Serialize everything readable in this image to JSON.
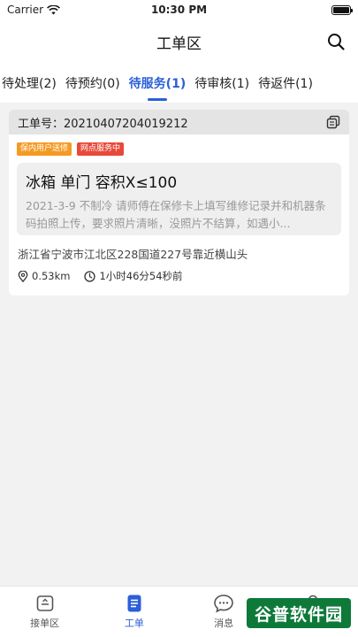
{
  "status_bar": {
    "carrier": "Carrier",
    "time": "10:30 PM"
  },
  "nav": {
    "title": "工单区"
  },
  "tabs": [
    {
      "label": "待处理(2)",
      "active": false
    },
    {
      "label": "待预约(0)",
      "active": false
    },
    {
      "label": "待服务(1)",
      "active": true
    },
    {
      "label": "待审核(1)",
      "active": false
    },
    {
      "label": "待返件(1)",
      "active": false
    }
  ],
  "order": {
    "number": "工单号：20210407204019212",
    "badges": [
      "保内用户送修",
      "网点服务中"
    ],
    "product_title": "冰箱  单门 容积X≤100",
    "description": "2021-3-9 不制冷 请师傅在保修卡上填写维修记录并和机器条码拍照上传，要求照片清晰，没照片不结算，如遇小...",
    "address": "浙江省宁波市江北区228国道227号靠近横山头",
    "distance": "0.53km",
    "elapsed": "1小时46分54秒前"
  },
  "tabbar": [
    {
      "label": "接单区",
      "icon": "inbox-icon",
      "active": false
    },
    {
      "label": "工单",
      "icon": "document-icon",
      "active": true
    },
    {
      "label": "消息",
      "icon": "chat-icon",
      "active": false
    }
  ],
  "watermark": {
    "text": "谷普软件园"
  },
  "colors": {
    "accent": "#2b5fd9",
    "badge_orange": "#f59a23",
    "badge_red": "#e8493a",
    "watermark_green": "#0e7a3a"
  }
}
